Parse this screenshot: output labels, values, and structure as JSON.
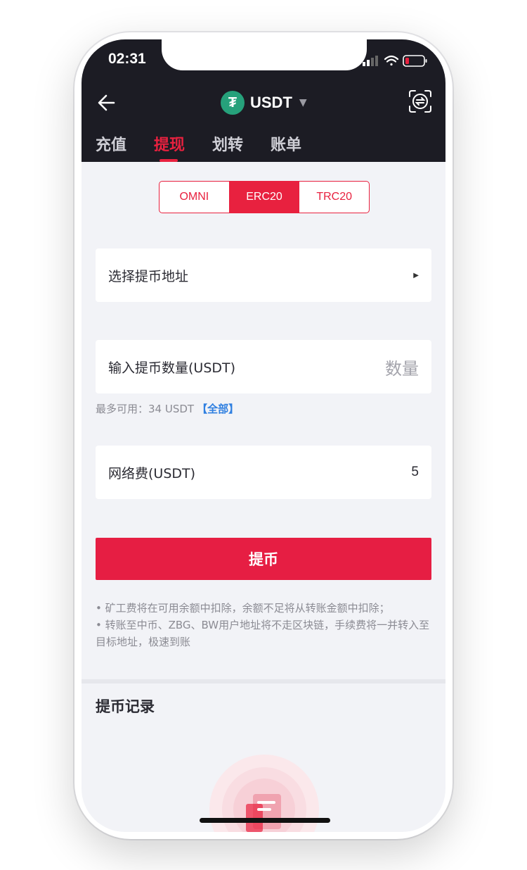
{
  "status": {
    "time": "02:31"
  },
  "nav": {
    "coin": "USDT",
    "coin_symbol": "₮"
  },
  "tabs": [
    {
      "label": "充值",
      "active": false
    },
    {
      "label": "提现",
      "active": true
    },
    {
      "label": "划转",
      "active": false
    },
    {
      "label": "账单",
      "active": false
    }
  ],
  "chains": [
    {
      "label": "OMNI",
      "active": false
    },
    {
      "label": "ERC20",
      "active": true
    },
    {
      "label": "TRC20",
      "active": false
    }
  ],
  "form": {
    "address_label": "选择提币地址",
    "amount_label": "输入提币数量(USDT)",
    "amount_placeholder": "数量",
    "available_text": "最多可用：34 USDT",
    "all_link": "【全部】",
    "fee_label": "网络费(USDT)",
    "fee_value": "5"
  },
  "submit_label": "提币",
  "notes": [
    "• 矿工费将在可用余额中扣除，余额不足将从转账金额中扣除；",
    "• 转账至中币、ZBG、BW用户地址将不走区块链，手续费将一并转入至目标地址，极速到账"
  ],
  "records": {
    "title": "提币记录"
  },
  "colors": {
    "accent": "#e8213f",
    "header_bg": "#1c1c24",
    "tether_green": "#26a17b",
    "link_blue": "#2f7fe0"
  },
  "icons": [
    "back-arrow-icon",
    "tether-icon",
    "caret-down-icon",
    "swap-scan-icon",
    "chevron-right-icon",
    "signal-icon",
    "wifi-icon",
    "battery-icon",
    "empty-record-icon"
  ]
}
